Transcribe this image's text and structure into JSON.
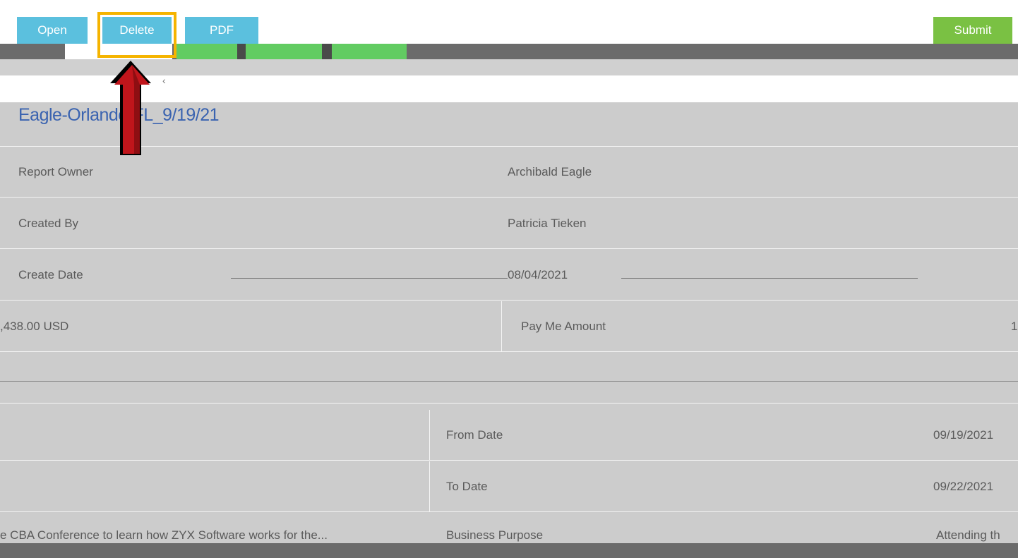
{
  "toolbar": {
    "open_label": "Open",
    "delete_label": "Delete",
    "pdf_label": "PDF",
    "submit_label": "Submit"
  },
  "report": {
    "title": "Eagle-Orlando-FL_9/19/21",
    "fields": {
      "report_owner_label": "Report Owner",
      "report_owner_value": "Archibald Eagle",
      "created_by_label": "Created By",
      "created_by_value": "Patricia Tieken",
      "create_date_label": "Create Date",
      "create_date_value": "08/04/2021",
      "amount_value": ",438.00 USD",
      "pay_me_amount_label": "Pay Me Amount",
      "pay_me_amount_value": "1",
      "from_date_label": "From Date",
      "from_date_value": "09/19/2021",
      "to_date_label": "To Date",
      "to_date_value": "09/22/2021",
      "business_purpose_text": "e CBA Conference to learn how ZYX Software works for the...",
      "business_purpose_label": "Business Purpose",
      "business_purpose_value": "Attending th"
    }
  },
  "colors": {
    "button_blue": "#5bc0de",
    "submit_green": "#7ac143",
    "highlight_yellow": "#f5b400",
    "arrow_red": "#c0151b",
    "title_blue": "#3a63b0"
  },
  "icons": {
    "annotation": "up-arrow-annotation"
  }
}
